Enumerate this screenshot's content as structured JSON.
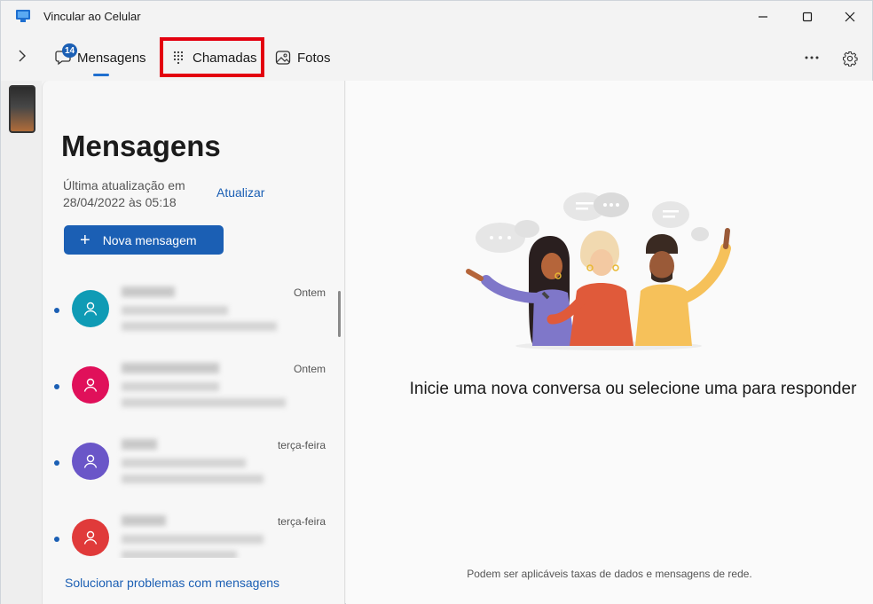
{
  "window": {
    "title": "Vincular ao Celular"
  },
  "tabs": [
    {
      "label": "Mensagens",
      "badge": "14",
      "icon": "chat-bubble-icon",
      "selected": true
    },
    {
      "label": "Chamadas",
      "icon": "dialpad-icon",
      "selected": false
    },
    {
      "label": "Fotos",
      "icon": "photo-icon",
      "selected": false
    }
  ],
  "messages_panel": {
    "title": "Mensagens",
    "last_update": "Última atualização em 28/04/2022 às 05:18",
    "refresh_label": "Atualizar",
    "new_message_label": "Nova mensagem",
    "troubleshoot_label": "Solucionar problemas com mensagens",
    "conversations": [
      {
        "time": "Ontem",
        "avatar_color": "#0f9bb5",
        "unread": true
      },
      {
        "time": "Ontem",
        "avatar_color": "#e0105a",
        "unread": true
      },
      {
        "time": "terça-feira",
        "avatar_color": "#6a56c8",
        "unread": true
      },
      {
        "time": "terça-feira",
        "avatar_color": "#e03a3a",
        "unread": true
      }
    ]
  },
  "empty_state": {
    "message": "Inicie uma nova conversa ou selecione uma para responder",
    "footnote": "Podem ser aplicáveis taxas de dados e mensagens de rede."
  },
  "colors": {
    "accent": "#1b5fb4",
    "highlight": "#e3000f"
  }
}
